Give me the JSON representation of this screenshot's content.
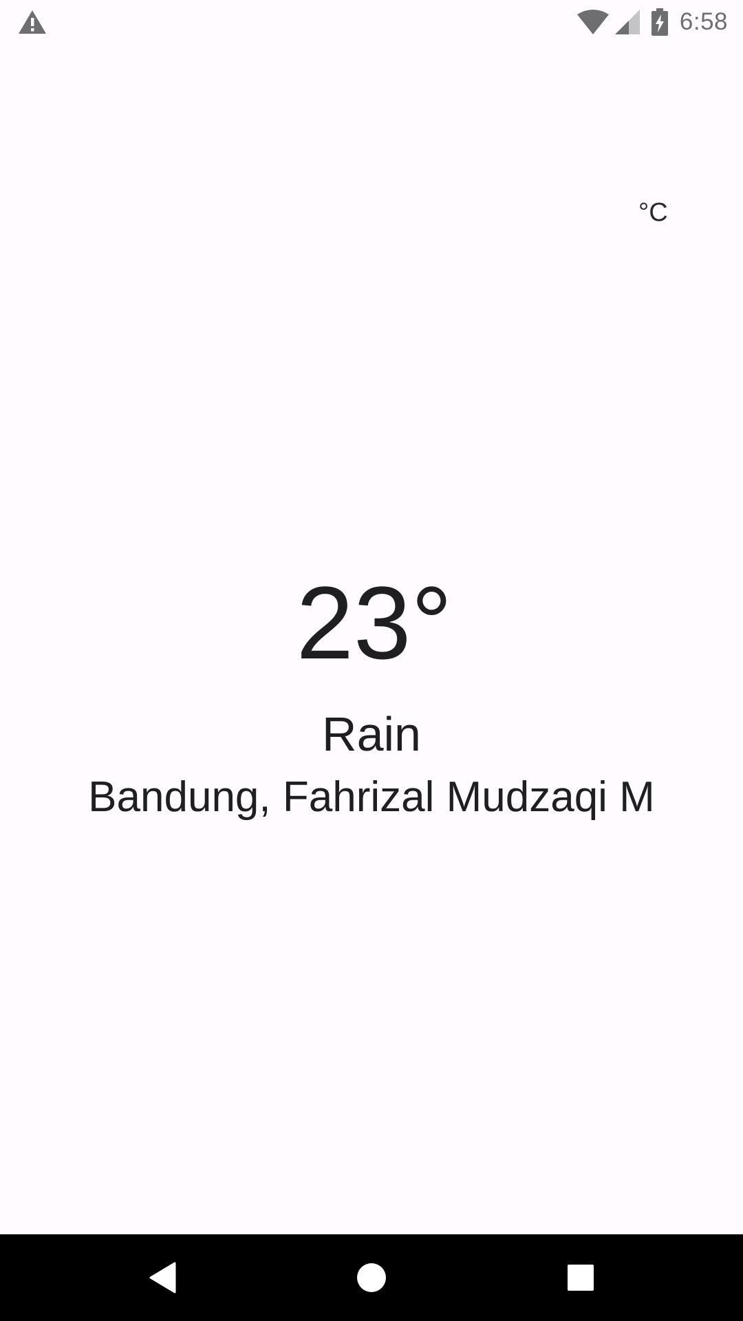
{
  "status_bar": {
    "time": "6:58",
    "icons": [
      "warning-icon",
      "wifi-icon",
      "cell-signal-icon",
      "battery-charging-icon"
    ]
  },
  "weather": {
    "unit_label": "°C",
    "temperature": "23°",
    "condition": "Rain",
    "location": "Bandung, Fahrizal Mudzaqi M"
  },
  "nav_bar": {
    "icons": [
      "back-icon",
      "home-icon",
      "recents-icon"
    ]
  },
  "colors": {
    "background": "#fffbfe",
    "text": "#1f1f22",
    "status_icon": "#6e6e70",
    "nav_background": "#000000",
    "nav_icon": "#ffffff"
  }
}
